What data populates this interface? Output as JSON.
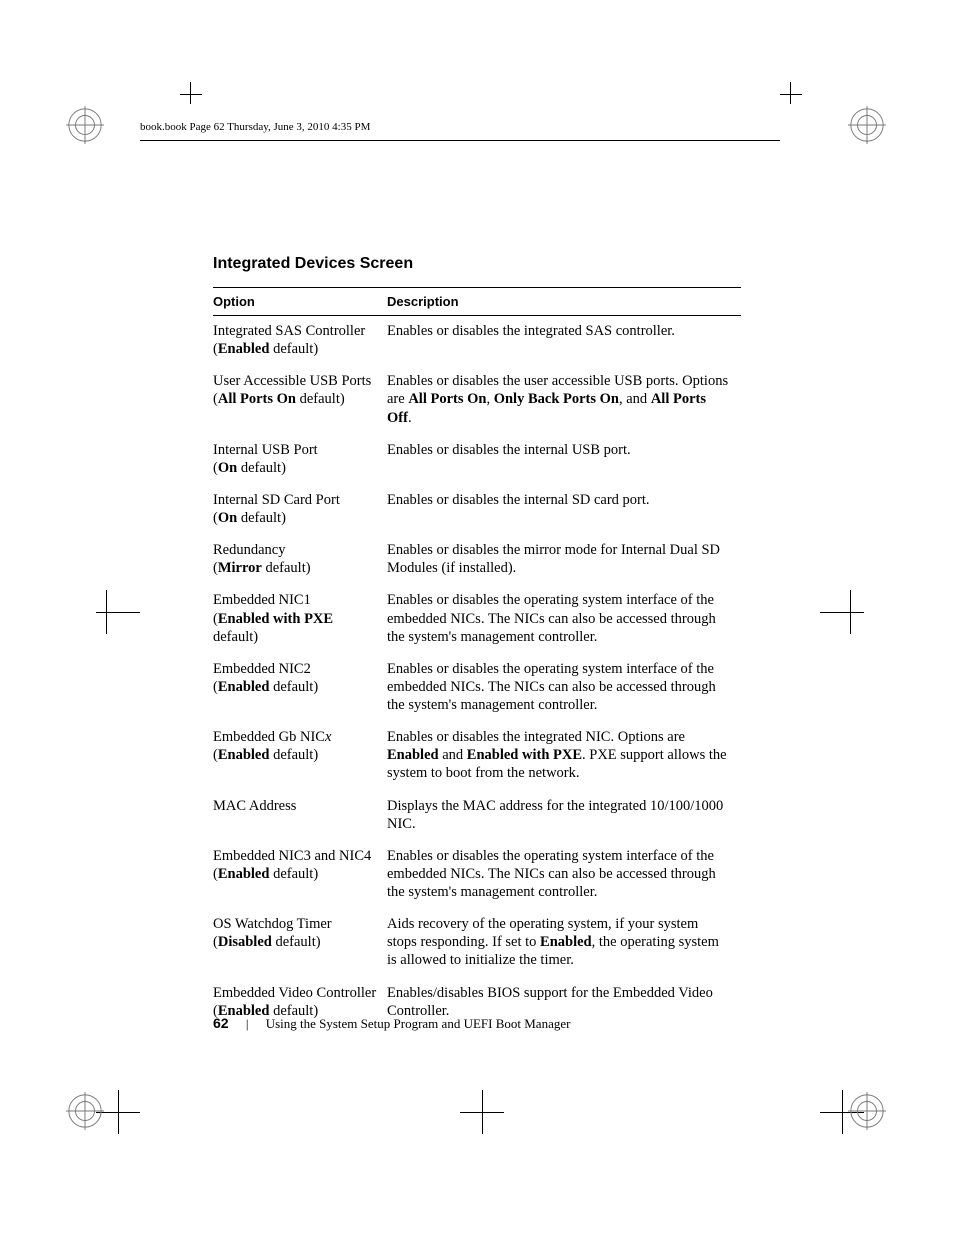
{
  "header_running": "book.book  Page 62  Thursday, June 3, 2010  4:35 PM",
  "section_title": "Integrated Devices Screen",
  "table": {
    "headers": {
      "option": "Option",
      "description": "Description"
    },
    "rows": [
      {
        "opt_pre": "Integrated SAS Controller",
        "opt_paren_pre": "(",
        "opt_bold": "Enabled",
        "opt_paren_post": " default)",
        "desc": "Enables or disables the integrated SAS controller."
      },
      {
        "opt_pre": "User Accessible USB Ports",
        "opt_paren_pre": "(",
        "opt_bold": "All Ports On",
        "opt_paren_post": " default)",
        "desc_pre": "Enables or disables the user accessible USB ports. Options are ",
        "desc_b1": "All Ports On",
        "desc_mid1": ", ",
        "desc_b2": "Only Back Ports On",
        "desc_mid2": ", and ",
        "desc_b3": "All Ports Off",
        "desc_post": "."
      },
      {
        "opt_pre": "Internal USB Port",
        "opt_paren_pre": "(",
        "opt_bold": "On",
        "opt_paren_post": " default)",
        "desc": "Enables or disables the internal USB port."
      },
      {
        "opt_pre": "Internal SD Card Port",
        "opt_paren_pre": "(",
        "opt_bold": "On",
        "opt_paren_post": " default)",
        "desc": "Enables or disables the internal SD card port."
      },
      {
        "opt_pre": "Redundancy",
        "opt_paren_pre": "(",
        "opt_bold": "Mirror",
        "opt_paren_post": " default)",
        "desc": "Enables or disables the mirror mode for Internal Dual SD Modules (if installed)."
      },
      {
        "opt_pre": "Embedded NIC1",
        "opt_paren_pre": "(",
        "opt_bold": "Enabled with PXE",
        "opt_paren_post": " default)",
        "desc": "Enables or disables the operating system interface of the embedded NICs. The NICs can also be accessed through the system's management controller."
      },
      {
        "opt_pre": "Embedded NIC2",
        "opt_paren_pre": "(",
        "opt_bold": "Enabled",
        "opt_paren_post": " default)",
        "desc": "Enables or disables the operating system interface of the embedded NICs. The NICs can also be accessed through the system's management controller."
      },
      {
        "opt_pre": "Embedded Gb NIC",
        "opt_ital": "x",
        "opt_paren_pre": "(",
        "opt_bold": "Enabled",
        "opt_paren_post": " default)",
        "desc_pre": "Enables or disables the integrated NIC. Options are ",
        "desc_b1": "Enabled",
        "desc_mid1": " and ",
        "desc_b2": "Enabled with PXE",
        "desc_post": ". PXE support allows the system to boot from the network."
      },
      {
        "opt_pre": "MAC Address",
        "desc": "Displays the MAC address for the integrated 10/100/1000 NIC."
      },
      {
        "opt_pre": "Embedded NIC3 and NIC4",
        "opt_paren_pre": "(",
        "opt_bold": "Enabled",
        "opt_paren_post": " default)",
        "desc": "Enables or disables the operating system interface of the embedded NICs. The NICs can also be accessed through the system's management controller."
      },
      {
        "opt_pre": "OS Watchdog Timer",
        "opt_paren_pre": "(",
        "opt_bold": "Disabled",
        "opt_paren_post": " default)",
        "desc_pre": "Aids recovery of the operating system, if your system stops responding. If set to ",
        "desc_b1": "Enabled",
        "desc_post": ", the operating system is allowed to initialize the timer."
      },
      {
        "opt_pre": "Embedded Video Controller",
        "opt_paren_pre": "(",
        "opt_bold": "Enabled",
        "opt_paren_post": " default)",
        "desc": "Enables/disables BIOS support for the Embedded Video Controller."
      }
    ]
  },
  "footer": {
    "page_number": "62",
    "section": "Using the System Setup Program and UEFI Boot Manager"
  }
}
